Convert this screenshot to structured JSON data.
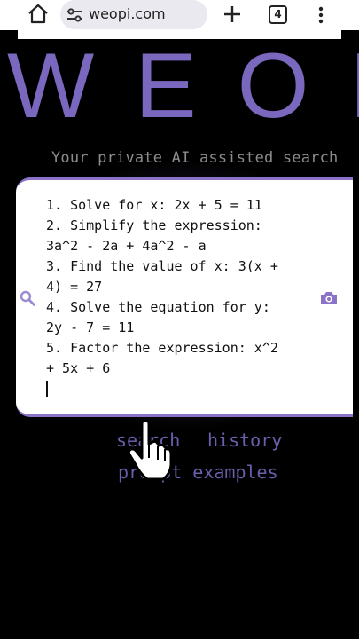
{
  "browser": {
    "url": "weopi.com",
    "tab_count": "4",
    "icons": [
      "home-icon",
      "site-settings-icon",
      "new-tab-icon",
      "tab-switcher-icon",
      "more-menu-icon"
    ]
  },
  "logo": {
    "text": "WEOP"
  },
  "tagline": "Your private AI assisted search",
  "search_box": {
    "value": "1. Solve for x: 2x + 5 = 11\n2. Simplify the expression:\n3a^2 - 2a + 4a^2 - a\n3. Find the value of x: 3(x +\n4) = 27\n4. Solve the equation for y:\n2y - 7 = 11\n5. Factor the expression: x^2\n+ 5x + 6",
    "icons": [
      "search-icon",
      "camera-icon"
    ]
  },
  "links": {
    "search": "search",
    "history": "history",
    "prompt_examples": "prompt examples"
  },
  "colors": {
    "accent": "#8a73c8",
    "link": "#6d5fae",
    "background": "#000000"
  }
}
